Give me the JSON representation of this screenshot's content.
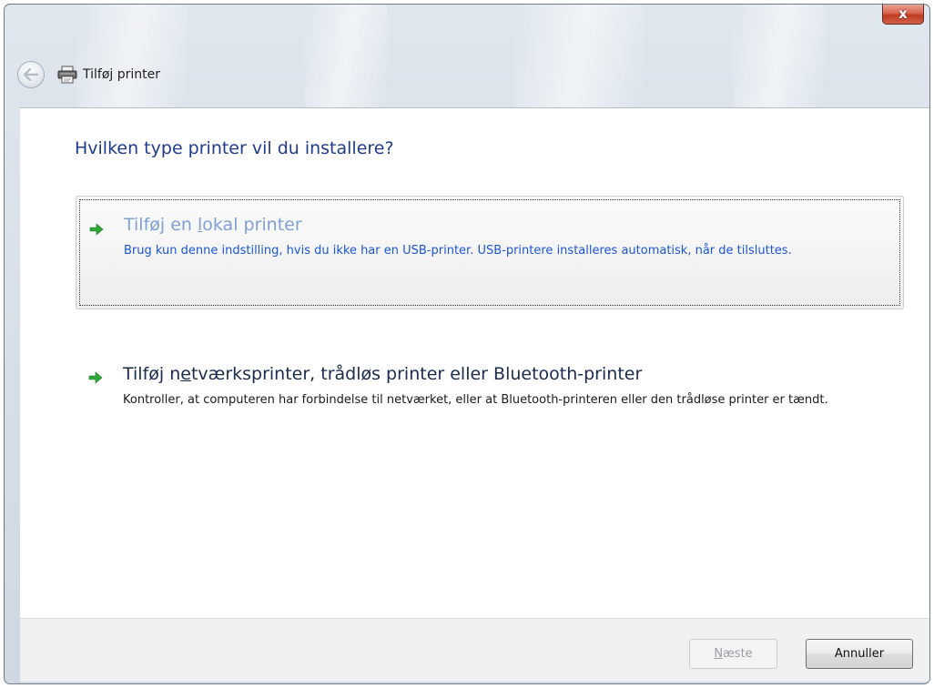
{
  "window": {
    "title": "Tilføj printer",
    "close_label": "x"
  },
  "icons": {
    "back": "back-arrow-icon",
    "printer": "printer-icon",
    "option_arrow": "green-arrow-icon",
    "close": "close-icon"
  },
  "main": {
    "heading": "Hvilken type printer vil du installere?",
    "options": [
      {
        "title_before": "Tilføj en ",
        "title_accel": "l",
        "title_after": "okal printer",
        "description": "Brug kun denne indstilling, hvis du ikke har en USB-printer. USB-printere installeres automatisk, når de tilsluttes."
      },
      {
        "title_before": "Tilføj n",
        "title_accel": "e",
        "title_after": "tværksprinter, trådløs printer eller Bluetooth-printer",
        "description": "Kontroller, at computeren har forbindelse til netværket, eller at Bluetooth-printeren eller den trådløse printer er tændt."
      }
    ]
  },
  "footer": {
    "next_label_accel": "N",
    "next_label_rest": "æste",
    "cancel_label": "Annuller"
  },
  "colors": {
    "heading": "#1e3b8c",
    "link_title_hover": "#7fa1d6",
    "link_desc_hover": "#1a56d8",
    "arrow_green": "#2fa83a",
    "close_red": "#c8432b"
  }
}
